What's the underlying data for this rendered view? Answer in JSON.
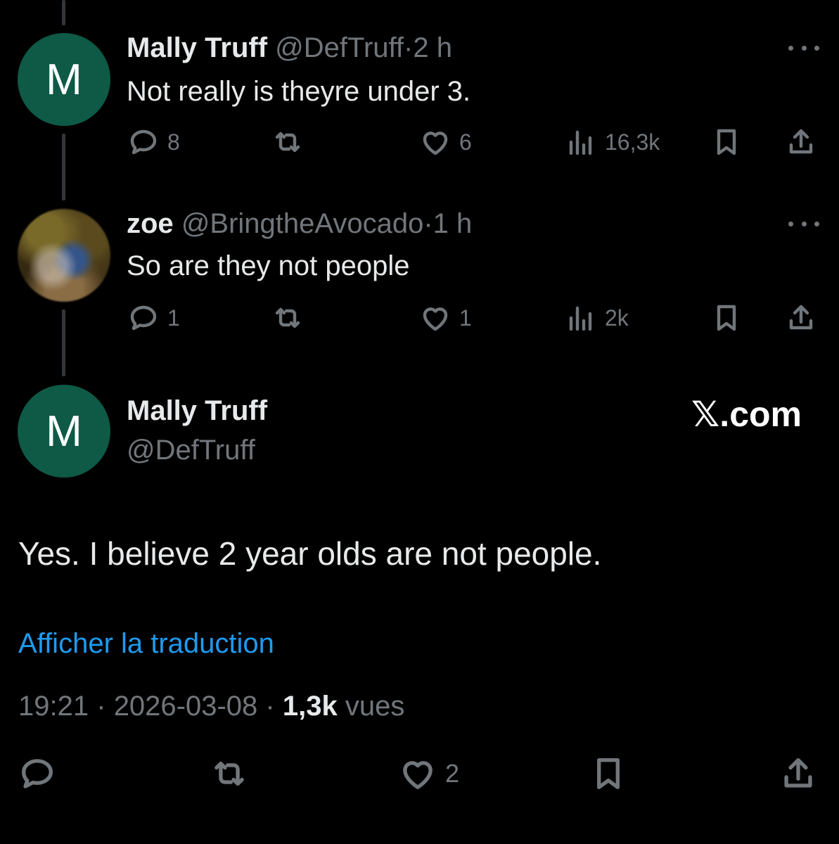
{
  "tweets": [
    {
      "avatar_letter": "M",
      "name": "Mally Truff",
      "handle": "@DefTruff",
      "time": "2 h",
      "text": "Not really is theyre under 3.",
      "replies": "8",
      "likes": "6",
      "views": "16,3k"
    },
    {
      "name": "zoe",
      "handle": "@BringtheAvocado",
      "time": "1 h",
      "text": "So are they not people",
      "replies": "1",
      "likes": "1",
      "views": "2k"
    }
  ],
  "main": {
    "avatar_letter": "M",
    "name": "Mally Truff",
    "handle": "@DefTruff",
    "watermark": "𝕏.com",
    "text": "Yes. I believe 2 year olds are not people.",
    "translate_link": "Afficher la traduction",
    "time": "19:21",
    "date": "2026-03-08",
    "views_count": "1,3k",
    "views_label": "vues",
    "likes": "2"
  },
  "separator": "·",
  "colors": {
    "background": "#000000",
    "text": "#e7e9ea",
    "muted": "#71767b",
    "link": "#1d9bf0",
    "avatar": "#0e5a47"
  }
}
